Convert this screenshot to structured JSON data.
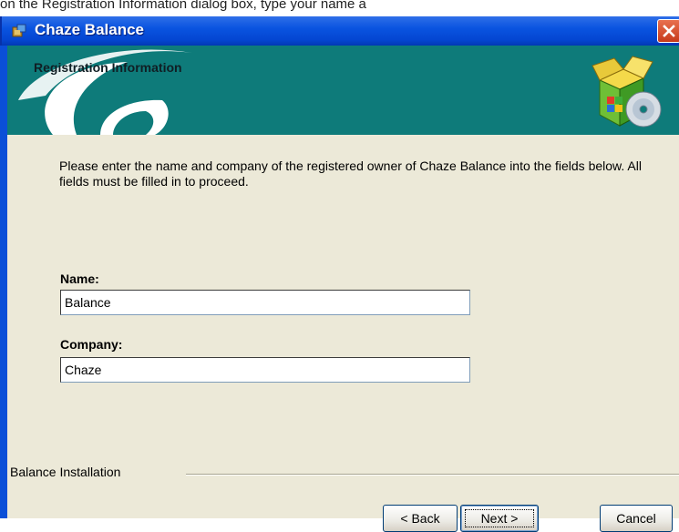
{
  "caption": "on the Registration Information dialog box, type your name a",
  "window": {
    "title": "Chaze Balance"
  },
  "banner": {
    "title": "Registration Information"
  },
  "instructions": "Please enter the name and company of the registered owner of Chaze Balance into the fields below. All fields must be filled in to proceed.",
  "form": {
    "name_label": "Name:",
    "name_value": "Balance",
    "company_label": "Company:",
    "company_value": "Chaze"
  },
  "footer": {
    "group_label": "Balance Installation"
  },
  "buttons": {
    "back": "< Back",
    "next": "Next >",
    "cancel": "Cancel"
  },
  "icons": {
    "app": "installer-icon",
    "close": "close-icon",
    "banner": "software-box-icon",
    "logo": "logo-swirl"
  },
  "colors": {
    "titlebar": "#0a54e0",
    "banner": "#0e7b7a",
    "dialog": "#ece9d8",
    "close": "#d9532c"
  }
}
